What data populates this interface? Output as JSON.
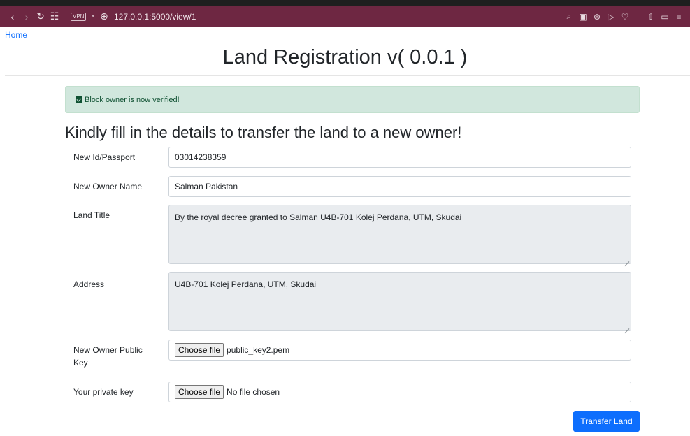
{
  "browser": {
    "url": "127.0.0.1:5000/view/1",
    "vpn_label": "VPN"
  },
  "nav": {
    "home_link": "Home"
  },
  "page": {
    "title": "Land Registration v( 0.0.1 )"
  },
  "alert": {
    "message": "Block owner is now verified!"
  },
  "form": {
    "heading": "Kindly fill in the details to transfer the land to a new owner!",
    "new_id": {
      "label": "New Id/Passport",
      "value": "03014238359"
    },
    "new_owner_name": {
      "label": "New Owner Name",
      "value": "Salman Pakistan"
    },
    "land_title": {
      "label": "Land Title",
      "value": "By the royal decree granted to Salman U4B-701 Kolej Perdana, UTM, Skudai"
    },
    "address": {
      "label": "Address",
      "value": "U4B-701 Kolej Perdana, UTM, Skudai"
    },
    "public_key": {
      "label": "New Owner Public Key",
      "button": "Choose file",
      "file": "public_key2.pem"
    },
    "private_key": {
      "label": "Your private key",
      "button": "Choose file",
      "file": "No file chosen"
    },
    "submit": "Transfer Land"
  },
  "colors": {
    "browser_bar": "#6e2742",
    "alert_bg": "#d1e7dd",
    "alert_text": "#0f5132",
    "primary": "#0d6efd",
    "readonly_bg": "#e9ecef"
  }
}
